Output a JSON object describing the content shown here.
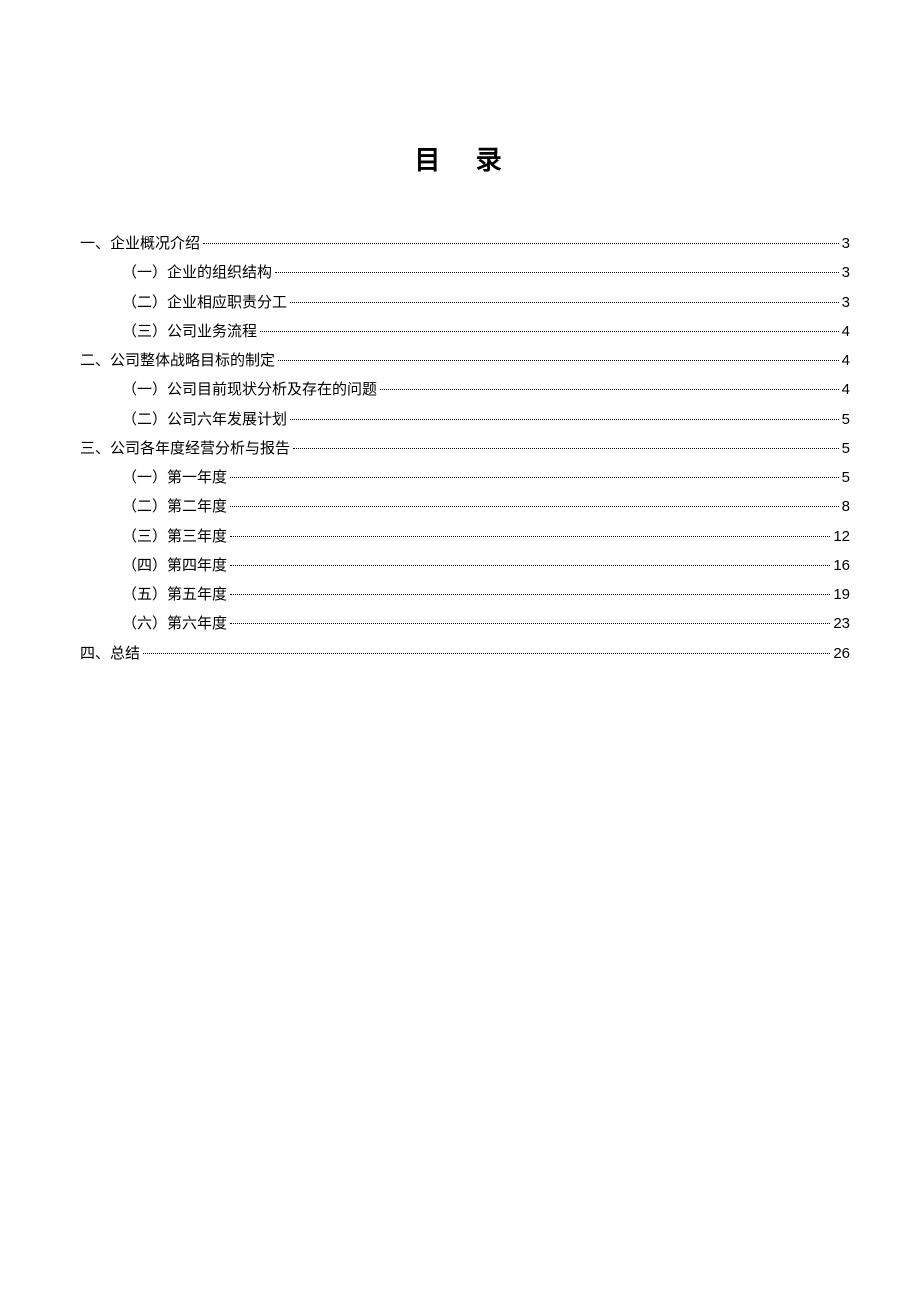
{
  "title": "目 录",
  "toc": [
    {
      "level": 1,
      "label": "一、企业概况介绍",
      "page": "3"
    },
    {
      "level": 2,
      "label": "（一）企业的组织结构",
      "page": "3"
    },
    {
      "level": 2,
      "label": "（二）企业相应职责分工",
      "page": "3"
    },
    {
      "level": 2,
      "label": "（三）公司业务流程",
      "page": "4"
    },
    {
      "level": 1,
      "label": "二、公司整体战略目标的制定",
      "page": "4"
    },
    {
      "level": 2,
      "label": "（一）公司目前现状分析及存在的问题",
      "page": "4"
    },
    {
      "level": 2,
      "label": "（二）公司六年发展计划",
      "page": "5"
    },
    {
      "level": 1,
      "label": "三、公司各年度经营分析与报告",
      "page": "5"
    },
    {
      "level": 2,
      "label": "（一）第一年度",
      "page": "5"
    },
    {
      "level": 2,
      "label": "（二）第二年度",
      "page": "8"
    },
    {
      "level": 2,
      "label": "（三）第三年度",
      "page": "12"
    },
    {
      "level": 2,
      "label": "（四）第四年度",
      "page": "16"
    },
    {
      "level": 2,
      "label": "（五）第五年度",
      "page": "19"
    },
    {
      "level": 2,
      "label": "（六）第六年度",
      "page": "23"
    },
    {
      "level": 1,
      "label": "四、总结",
      "page": "26"
    }
  ]
}
